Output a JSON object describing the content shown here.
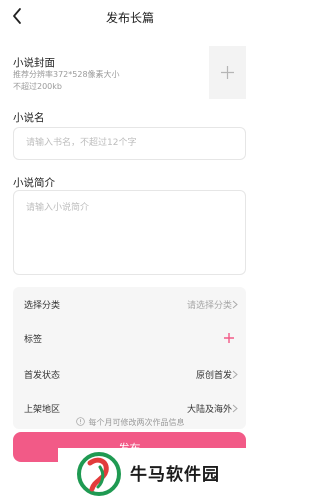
{
  "header": {
    "title": "发布长篇"
  },
  "cover": {
    "label": "小说封面",
    "hint_line1": "推荐分辨率372*528像素大小",
    "hint_line2": "不超过200kb"
  },
  "name": {
    "label": "小说名",
    "placeholder": "请输入书名，不超过12个字"
  },
  "intro": {
    "label": "小说简介",
    "placeholder": "请输入小说简介"
  },
  "settings": {
    "rows": [
      {
        "label": "选择分类",
        "value": "请选择分类"
      },
      {
        "label": "标签",
        "value": ""
      },
      {
        "label": "首发状态",
        "value": "原创首发"
      },
      {
        "label": "上架地区",
        "value": "大陆及海外"
      }
    ]
  },
  "notice": "每个月可修改两次作品信息",
  "publish_label": "发布",
  "watermark": {
    "text": "牛马软件园"
  },
  "colors": {
    "accent": "#f25a87",
    "placeholder": "#bdbdbd",
    "panel": "#f6f6f6"
  }
}
